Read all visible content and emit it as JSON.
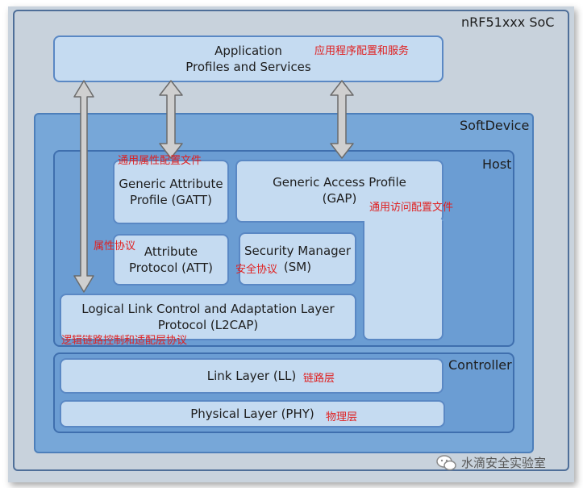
{
  "labels": {
    "soc": "nRF51xxx SoC",
    "softdevice": "SoftDevice",
    "host": "Host",
    "controller": "Controller"
  },
  "blocks": {
    "app_line1": "Application",
    "app_line2": "Profiles and Services",
    "gatt_line1": "Generic Attribute",
    "gatt_line2": "Profile (GATT)",
    "gap_line1": "Generic Access Profile",
    "gap_line2": "(GAP)",
    "att_line1": "Attribute",
    "att_line2": "Protocol (ATT)",
    "sm_line1": "Security Manager",
    "sm_line2": "(SM)",
    "l2cap_line1": "Logical Link Control and Adaptation Layer",
    "l2cap_line2": "Protocol (L2CAP)",
    "ll": "Link Layer (LL)",
    "phy": "Physical Layer (PHY)"
  },
  "annotations": {
    "app": "应用程序配置和服务",
    "gatt": "通用属性配置文件",
    "att": "属性协议",
    "sm": "安全协议",
    "gap": "通用访问配置文件",
    "l2cap": "逻辑链路控制和适配层协议",
    "ll": "链路层",
    "phy": "物理层"
  },
  "watermark": "水滴安全实验室",
  "colors": {
    "soc_bg": "#c8d2dc",
    "softdevice_bg": "#77a7d8",
    "layer_bg": "#6b9dd3",
    "block_bg": "#c5dbf1",
    "annotation": "#e02020",
    "arrow": "#cfcfcf"
  }
}
